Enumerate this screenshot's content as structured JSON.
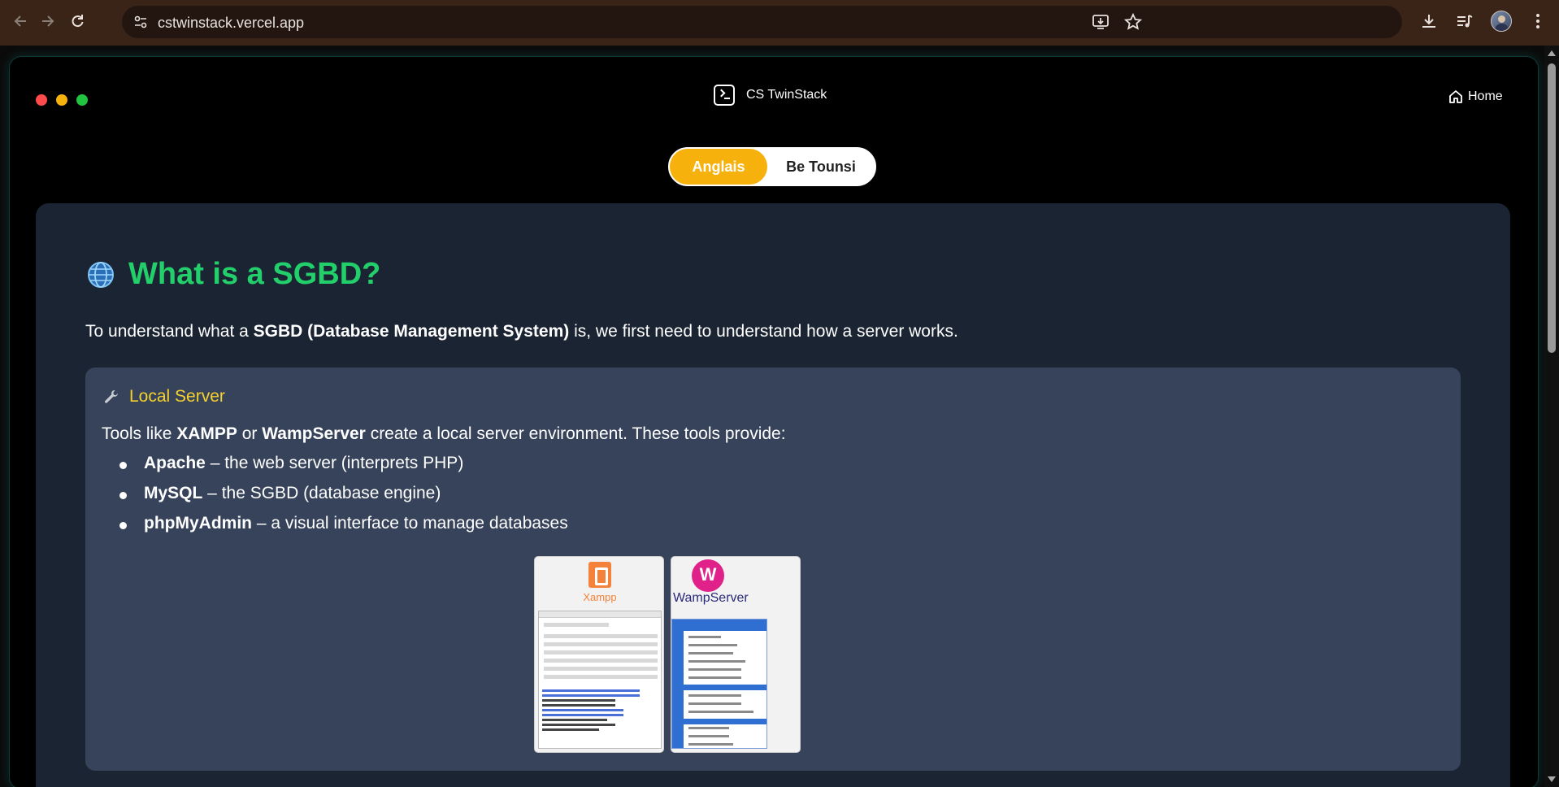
{
  "browser": {
    "url": "cstwinstack.vercel.app",
    "icons": {
      "back": "arrow-left-icon",
      "forward": "arrow-right-icon",
      "reload": "reload-icon",
      "site_info": "tune-icon",
      "install": "install-app-icon",
      "bookmark": "star-icon",
      "downloads": "download-icon",
      "media": "media-queue-icon",
      "menu": "kebab-menu-icon"
    }
  },
  "app": {
    "brand": "CS TwinStack",
    "home_label": "Home",
    "language_toggle": {
      "active": "Anglais",
      "inactive": "Be Tounsi"
    }
  },
  "content": {
    "title_icon": "globe-icon",
    "title": "What is a SGBD?",
    "intro": {
      "before": "To understand what a ",
      "bold": "SGBD (Database Management System)",
      "after": " is, we first need to understand how a server works."
    },
    "card": {
      "icon": "wrench-icon",
      "title": "Local Server",
      "lead": {
        "p1": "Tools like ",
        "b1": "XAMPP",
        "p2": " or ",
        "b2": "WampServer",
        "p3": " create a local server environment. These tools provide:"
      },
      "tools": [
        {
          "name": "Apache",
          "desc": " – the web server (interprets PHP)"
        },
        {
          "name": "MySQL",
          "desc": " – the SGBD (database engine)"
        },
        {
          "name": "phpMyAdmin",
          "desc": " – a visual interface to manage databases"
        }
      ],
      "images": [
        {
          "caption": "Xampp"
        },
        {
          "caption": "WampServer"
        }
      ]
    }
  },
  "colors": {
    "accent_green": "#22cf6a",
    "accent_yellow": "#f5d12e",
    "toggle_active": "#f7b10c",
    "panel_bg": "#1b2433",
    "card_bg": "#37435a"
  }
}
